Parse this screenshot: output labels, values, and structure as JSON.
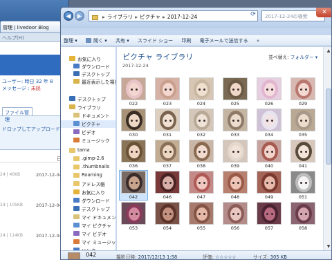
{
  "background_window": {
    "tab_title": "管理 | livedoor Blog",
    "menu_help": "ヘルプ(H)",
    "info_line1": "ユーザー:",
    "info_line1_link": "時日",
    "info_line1_count": "32 年 8",
    "info_line2": "メッセージ :",
    "info_line2_status": "未読",
    "subtab": "ファイル管理",
    "drop_hint": "ドロップしてアップロード ま",
    "col_header": "日時",
    "rows": [
      {
        "size": "24 | 40KB",
        "date": "2017-12-04 0"
      },
      {
        "size": "24 | 105KB",
        "date": "2017-12-04 0"
      },
      {
        "size": "24 | 114KB",
        "date": "2017-12-04 0"
      }
    ]
  },
  "address_bar": {
    "crumbs": [
      "ライブラリ",
      "ピクチャ",
      "2017-12-24"
    ]
  },
  "search": {
    "placeholder": "2017-12-24の検索"
  },
  "toolbar": {
    "organize": "整理 ▾",
    "open": "開く ▾",
    "share": "共有 ▾",
    "slideshow": "スライド ショー",
    "print": "印刷",
    "email": "電子メールで送信する",
    "more": "»"
  },
  "nav": {
    "items": [
      {
        "label": "お気に入り",
        "color": "#e3b33a"
      },
      {
        "label": "ダウンロード",
        "color": "#4b7bc4"
      },
      {
        "label": "デスクトップ",
        "color": "#3a6fb5"
      },
      {
        "label": "最近表示した場所",
        "color": "#d9b44a"
      },
      {
        "label": "",
        "color": ""
      },
      {
        "label": "デスクトップ",
        "color": "#3a6fb5"
      },
      {
        "label": "ライブラリ",
        "color": "#d9b44a"
      },
      {
        "label": "ドキュメント",
        "color": "#d9c27a"
      },
      {
        "label": "ピクチャ",
        "color": "#5a8fd1"
      },
      {
        "label": "ビデオ",
        "color": "#8a6ac0"
      },
      {
        "label": "ミュージック",
        "color": "#d87a3a"
      },
      {
        "label": "tama",
        "color": "#e8c66a"
      },
      {
        "label": ".gimp-2.6",
        "color": "#e8c66a"
      },
      {
        "label": ".thumbnails",
        "color": "#e8c66a"
      },
      {
        "label": "Roaming",
        "color": "#e8c66a"
      },
      {
        "label": "アドレス帳",
        "color": "#e8c66a"
      },
      {
        "label": "お気に入り",
        "color": "#e3b33a"
      },
      {
        "label": "ダウンロード",
        "color": "#4b7bc4"
      },
      {
        "label": "デスクトップ",
        "color": "#3a6fb5"
      },
      {
        "label": "マイ ドキュメント",
        "color": "#d9c27a"
      },
      {
        "label": "マイ ピクチャ",
        "color": "#5a8fd1"
      },
      {
        "label": "マイ ビデオ",
        "color": "#8a6ac0"
      },
      {
        "label": "マイ ミュージック",
        "color": "#d87a3a"
      },
      {
        "label": "リンク",
        "color": "#4b7bc4"
      }
    ]
  },
  "content": {
    "library_title": "ピクチャ ライブラリ",
    "library_date": "2017-12-24",
    "arrange_label": "並べ替え:",
    "arrange_value": "フォルダー ▾",
    "thumbnails": [
      {
        "label": "022",
        "bg": "#c7a898",
        "face": "#f3d6cf",
        "hair": "#e8c4c8"
      },
      {
        "label": "023",
        "bg": "#d6b2a6",
        "face": "#f4d8cf",
        "hair": "#caa08e"
      },
      {
        "label": "024",
        "bg": "#d8c6b4",
        "face": "#efe0d0",
        "hair": "#c8b8a2"
      },
      {
        "label": "025",
        "bg": "#7a6a54",
        "face": "#f0d8c8",
        "hair": "#6b5a44"
      },
      {
        "label": "026",
        "bg": "#e6cfe0",
        "face": "#f5dde0",
        "hair": "#e3b6d0"
      },
      {
        "label": "029",
        "bg": "#d8b9b2",
        "face": "#f4d9d2",
        "hair": "#b87870"
      },
      {
        "label": "030",
        "bg": "#a89278",
        "face": "#efd9c6",
        "hair": "#3a2e24"
      },
      {
        "label": "031",
        "bg": "#ddd0c0",
        "face": "#f1e1d2",
        "hair": "#7a6450"
      },
      {
        "label": "032",
        "bg": "#d4c6b8",
        "face": "#efe2d6",
        "hair": "#b8a896"
      },
      {
        "label": "033",
        "bg": "#c4b4a2",
        "face": "#ecdcce",
        "hair": "#8e7a66"
      },
      {
        "label": "034",
        "bg": "#cfc2d6",
        "face": "#f2e3e6",
        "hair": "#e8e4ee"
      },
      {
        "label": "035",
        "bg": "#b8a894",
        "face": "#ecdccc",
        "hair": "#a8988a"
      },
      {
        "label": "036",
        "bg": "#8a7458",
        "face": "#eed6c2",
        "hair": "#6a5236"
      },
      {
        "label": "037",
        "bg": "#c2ac92",
        "face": "#eed8c4",
        "hair": "#8a7058"
      },
      {
        "label": "038",
        "bg": "#cab6a6",
        "face": "#f2dcd0",
        "hair": "#8a6a50"
      },
      {
        "label": "039",
        "bg": "#d4c6ba",
        "face": "#f0e2d6",
        "hair": "#e4d8cc"
      },
      {
        "label": "040",
        "bg": "#c8a4a0",
        "face": "#f3d4cc",
        "hair": "#a65a50"
      },
      {
        "label": "041",
        "bg": "#d8c8bc",
        "face": "#f2e4d8",
        "hair": "#5a4a3c"
      },
      {
        "label": "042",
        "bg": "#7a6a64",
        "face": "#c8a48c",
        "hair": "#3a2c2a"
      },
      {
        "label": "046",
        "bg": "#7a3a3a",
        "face": "#d8b0a8",
        "hair": "#4a2424"
      },
      {
        "label": "047",
        "bg": "#c48a88",
        "face": "#f0c8c0",
        "hair": "#b05a58"
      },
      {
        "label": "048",
        "bg": "#b8806e",
        "face": "#eec4b6",
        "hair": "#9a5a48"
      },
      {
        "label": "049",
        "bg": "#a46458",
        "face": "#e8baac",
        "hair": "#7a3a30"
      },
      {
        "label": "051",
        "bg": "#8a8a8a",
        "face": "#f4f4f4",
        "hair": "#bdbdbd"
      },
      {
        "label": "053",
        "bg": "#6a4a58",
        "face": "#d48aa0",
        "hair": "#8a3a5a"
      },
      {
        "label": "054",
        "bg": "#7a5248",
        "face": "#c49080",
        "hair": "#5a3228"
      },
      {
        "label": "055",
        "bg": "#a67a6c",
        "face": "#e6b8a8",
        "hair": "#845446"
      },
      {
        "label": "056",
        "bg": "#b48c8a",
        "face": "#eac6c0",
        "hair": "#8c5c58"
      },
      {
        "label": "057",
        "bg": "#6a3c4a",
        "face": "#b86a80",
        "hair": "#4a2232"
      },
      {
        "label": "058",
        "bg": "#8a6470",
        "face": "#d4a4b0",
        "hair": "#6a3c4a"
      }
    ]
  },
  "details": {
    "filename": "042",
    "taken_label": "撮影日時:",
    "taken_value": "2017/12/13 1:58",
    "rating_label": "評価:",
    "rating_value": "☆☆☆☆☆",
    "size_label": "サイズ:",
    "size_value": "305 KB"
  }
}
